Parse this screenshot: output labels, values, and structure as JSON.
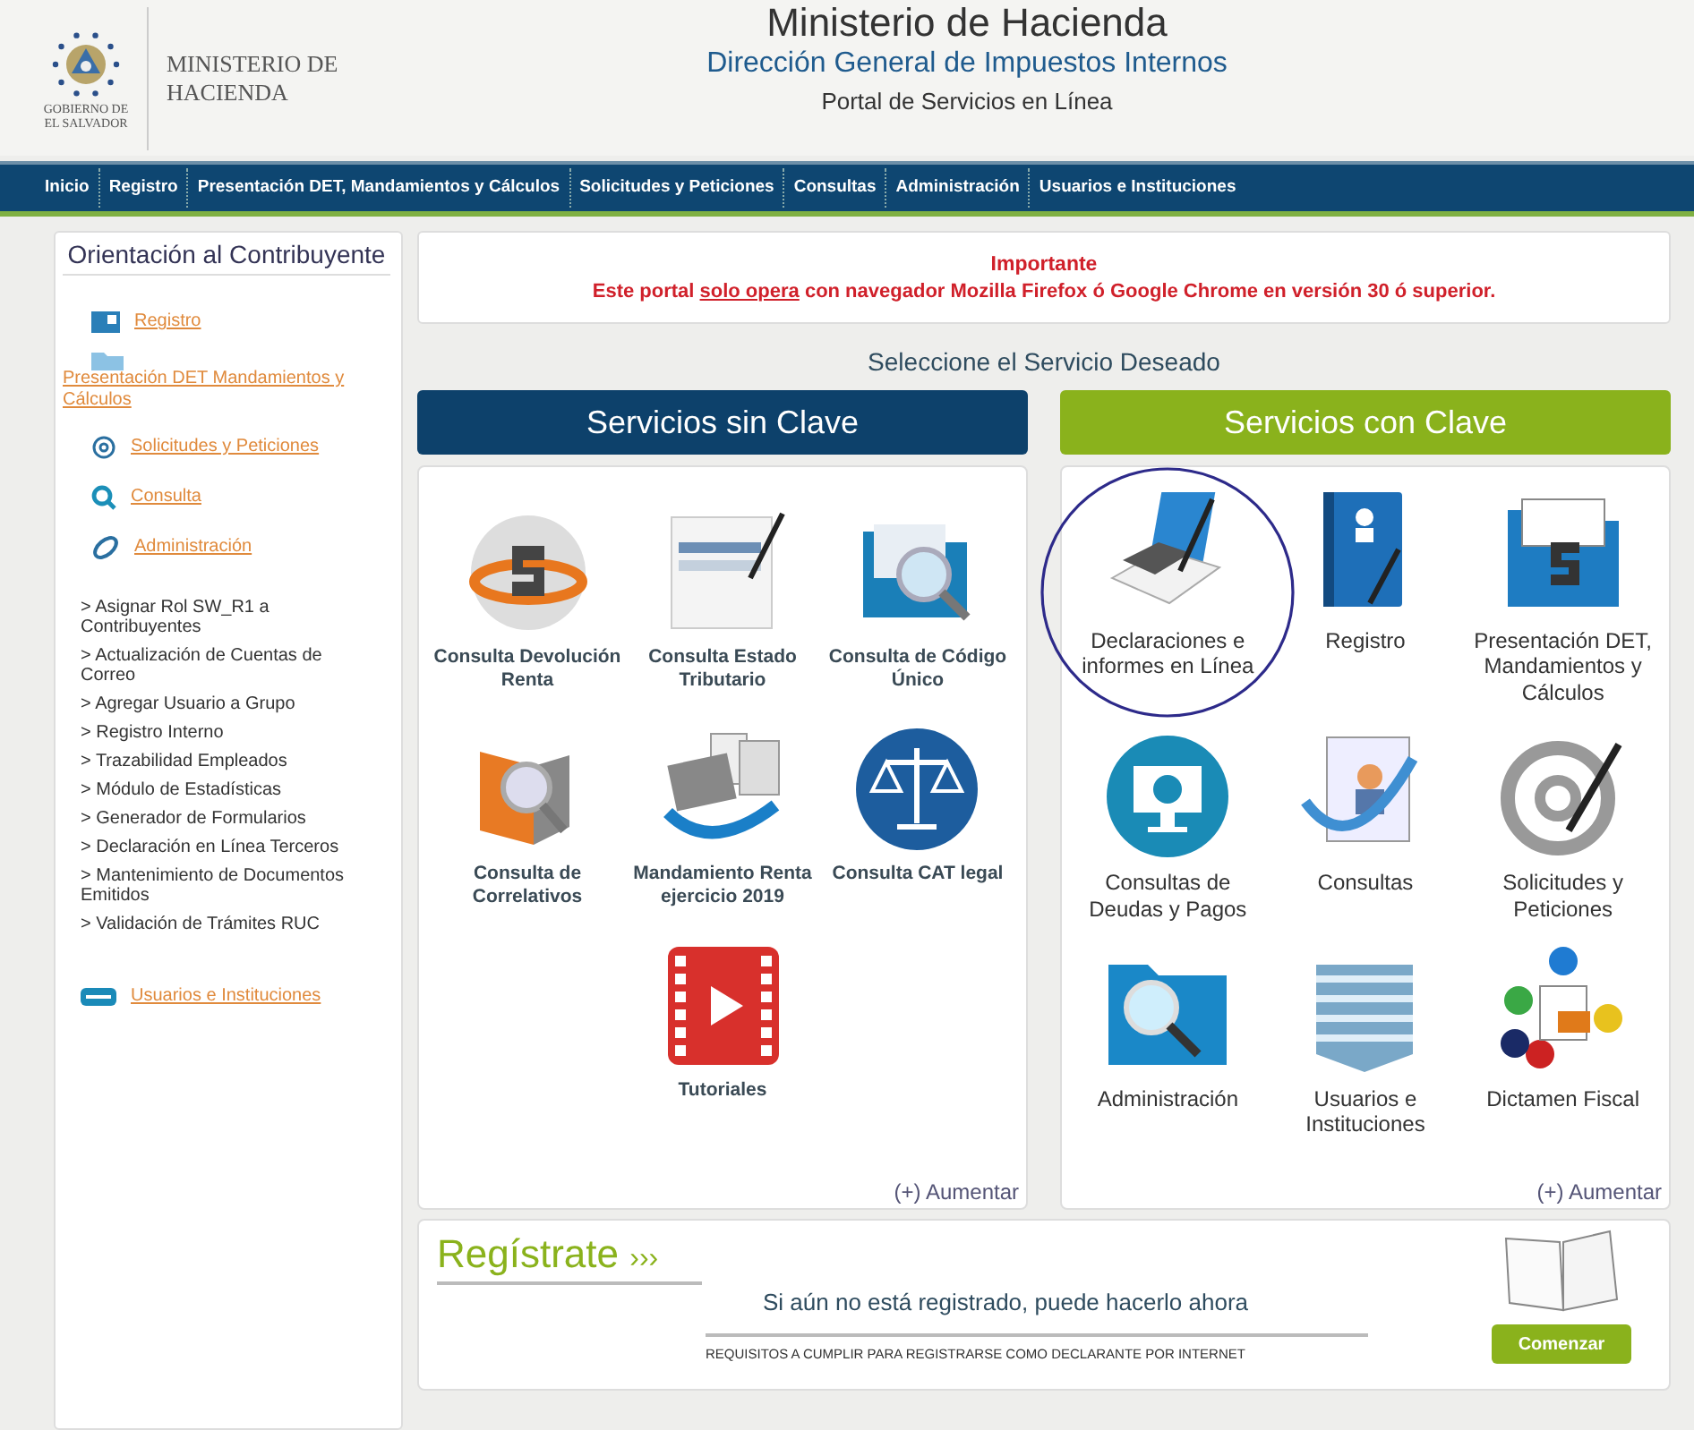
{
  "header": {
    "emblem_caption": "GOBIERNO DE EL SALVADOR",
    "ministry_name": "MINISTERIO DE HACIENDA",
    "title": "Ministerio de Hacienda",
    "subtitle": "Dirección General de Impuestos Internos",
    "portal": "Portal de Servicios en Línea"
  },
  "nav": [
    "Inicio",
    "Registro",
    "Presentación DET, Mandamientos y Cálculos",
    "Solicitudes y Peticiones",
    "Consultas",
    "Administración",
    "Usuarios e Instituciones"
  ],
  "sidebar": {
    "title": "Orientación al Contribuyente",
    "links": [
      {
        "label": "Registro"
      },
      {
        "label": "Presentación DET Mandamientos y Cálculos"
      },
      {
        "label": "Solicitudes y Peticiones"
      },
      {
        "label": "Consulta"
      },
      {
        "label": "Administración"
      }
    ],
    "admin_items": [
      "> Asignar Rol SW_R1 a Contribuyentes",
      "> Actualización de Cuentas de Correo",
      "> Agregar Usuario a Grupo",
      "> Registro Interno",
      "> Trazabilidad Empleados",
      "> Módulo de Estadísticas",
      "> Generador de Formularios",
      "> Declaración en Línea Terceros",
      "> Mantenimiento de Documentos Emitidos",
      "> Validación de Trámites RUC"
    ],
    "footer_link": "Usuarios e Instituciones"
  },
  "notice": {
    "title": "Importante",
    "text": "Este portal **solo opera** con navegador Mozilla Firefox ó Google Chrome en versión 30 ó superior."
  },
  "select_prompt": "Seleccione el Servicio Deseado",
  "sections": [
    {
      "title": "Servicios sin Clave",
      "kind": "free",
      "more": "(+) Aumentar",
      "services": [
        {
          "label": "Consulta Devolución Renta",
          "highlighted": false
        },
        {
          "label": "Consulta Estado Tributario",
          "highlighted": false
        },
        {
          "label": "Consulta de Código Único",
          "highlighted": false
        },
        {
          "label": "Consulta de Correlativos",
          "highlighted": false
        },
        {
          "label": "Mandamiento Renta ejercicio 2019",
          "highlighted": false
        },
        {
          "label": "Consulta CAT legal",
          "highlighted": false
        },
        {
          "label": "Tutoriales",
          "highlighted": false
        }
      ]
    },
    {
      "title": "Servicios con Clave",
      "kind": "key",
      "more": "(+) Aumentar",
      "services": [
        {
          "label": "Declaraciones e informes en Línea",
          "highlighted": true
        },
        {
          "label": "Registro",
          "highlighted": false
        },
        {
          "label": "Presentación DET, Mandamientos y Cálculos",
          "highlighted": false
        },
        {
          "label": "Consultas de Deudas y Pagos",
          "highlighted": false
        },
        {
          "label": "Consultas",
          "highlighted": false
        },
        {
          "label": "Solicitudes y Peticiones",
          "highlighted": false
        },
        {
          "label": "Administración",
          "highlighted": false
        },
        {
          "label": "Usuarios e Instituciones",
          "highlighted": false
        },
        {
          "label": "Dictamen Fiscal",
          "highlighted": false
        }
      ]
    }
  ],
  "register": {
    "title": "Regístrate",
    "arrows": "›››",
    "text": "Si aún no está registrado, puede hacerlo ahora",
    "requirements": "REQUISITOS A CUMPLIR PARA REGISTRARSE COMO DECLARANTE POR INTERNET",
    "button": "Comenzar"
  }
}
